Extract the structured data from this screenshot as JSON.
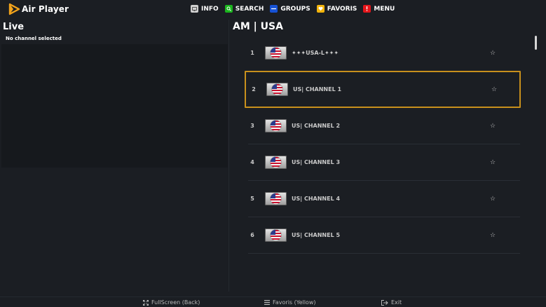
{
  "app": {
    "title": "Air Player",
    "brand_color": "#f2a31b"
  },
  "topnav": [
    {
      "label": "INFO",
      "icon": "info-key-icon",
      "color": "#d0d0d0"
    },
    {
      "label": "SEARCH",
      "icon": "search-key-icon",
      "color": "#1ab51d"
    },
    {
      "label": "GROUPS",
      "icon": "groups-key-icon",
      "color": "#1652d6"
    },
    {
      "label": "FAVORIS",
      "icon": "favoris-key-icon",
      "color": "#f2b40c"
    },
    {
      "label": "MENU",
      "icon": "menu-key-icon",
      "color": "#e4151a"
    }
  ],
  "live": {
    "title": "Live",
    "status": "No channel selected"
  },
  "group": {
    "title": "AM | USA"
  },
  "channels": [
    {
      "number": "1",
      "name": "✦✦✦USA-L✦✦✦",
      "selected": false,
      "favorite_icon": "star-outline-icon"
    },
    {
      "number": "2",
      "name": "US| CHANNEL 1",
      "selected": true,
      "favorite_icon": "star-outline-icon"
    },
    {
      "number": "3",
      "name": "US| CHANNEL 2",
      "selected": false,
      "favorite_icon": "star-outline-icon"
    },
    {
      "number": "4",
      "name": "US| CHANNEL 3",
      "selected": false,
      "favorite_icon": "star-outline-icon"
    },
    {
      "number": "5",
      "name": "US| CHANNEL 4",
      "selected": false,
      "favorite_icon": "star-outline-icon"
    },
    {
      "number": "6",
      "name": "US| CHANNEL 5",
      "selected": false,
      "favorite_icon": "star-outline-icon"
    }
  ],
  "footer": [
    {
      "label": "FullScreen (Back)",
      "icon": "fullscreen-icon"
    },
    {
      "label": "Favoris (Yellow)",
      "icon": "menu-lines-icon"
    },
    {
      "label": "Exit",
      "icon": "exit-icon"
    }
  ],
  "colors": {
    "background": "#1b1e23",
    "selection_border": "#c8901c"
  }
}
